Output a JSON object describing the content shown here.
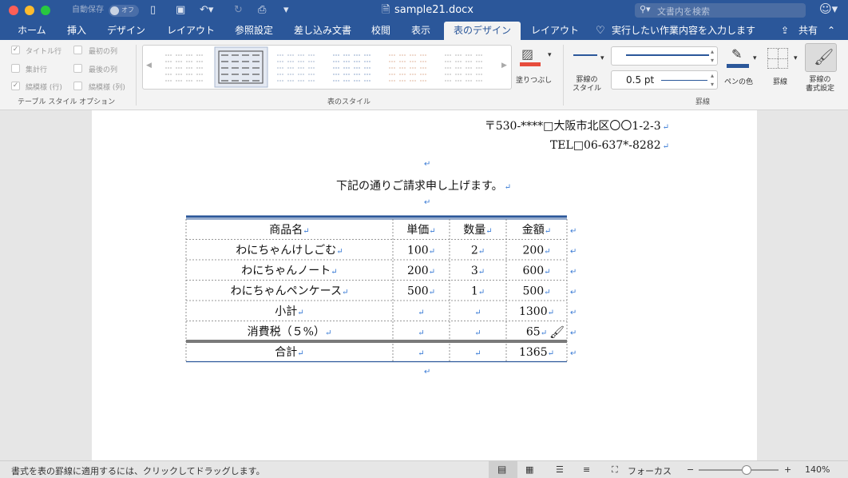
{
  "window": {
    "title": "sample21.docx"
  },
  "quick_access": {
    "autosave_label": "自動保存",
    "autosave_state": "オフ"
  },
  "search": {
    "placeholder": "文書内を検索"
  },
  "tabs": [
    "ホーム",
    "挿入",
    "デザイン",
    "レイアウト",
    "参照設定",
    "差し込み文書",
    "校閲",
    "表示",
    "表のデザイン",
    "レイアウト"
  ],
  "active_tab": "表のデザイン",
  "tell_me": "実行したい作業内容を入力します",
  "share": "共有",
  "style_options": {
    "items": [
      "タイトル行",
      "最初の列",
      "集計行",
      "最後の列",
      "縞模様 (行)",
      "縞模様 (列)"
    ],
    "checked": [
      true,
      false,
      false,
      false,
      true,
      false
    ],
    "group_label": "テーブル スタイル オプション"
  },
  "table_styles": {
    "group_label": "表のスタイル",
    "shading_label": "塗りつぶし"
  },
  "borders": {
    "border_style_label": "罫線の\nスタイル",
    "weight": "0.5 pt",
    "pen_color_label": "ペンの色",
    "borders_label": "罫線",
    "painter_label": "罫線の\n書式設定",
    "group_label": "罫線"
  },
  "colors": {
    "brand": "#2b579a",
    "pilcrow": "#3a7bd5",
    "fill_red": "#e74c3c",
    "pen_blue": "#2b579a"
  },
  "document": {
    "address": "〒530-****□大阪市北区〇〇1-2-3",
    "tel": "TEL□06-637*-8282",
    "intro": "下記の通りご請求申し上げます。",
    "table": {
      "headers": [
        "商品名",
        "単価",
        "数量",
        "金額"
      ],
      "rows": [
        [
          "わにちゃんけしごむ",
          "100",
          "2",
          "200"
        ],
        [
          "わにちゃんノート",
          "200",
          "3",
          "600"
        ],
        [
          "わにちゃんペンケース",
          "500",
          "1",
          "500"
        ],
        [
          "小計",
          "",
          "",
          "1300"
        ],
        [
          "消費税（５%）",
          "",
          "",
          "65"
        ],
        [
          "合計",
          "",
          "",
          "1365"
        ]
      ]
    }
  },
  "status": {
    "message": "書式を表の罫線に適用するには、クリックしてドラッグします。",
    "focus_label": "フォーカス",
    "zoom": "140%",
    "zoom_level": 0.6
  }
}
